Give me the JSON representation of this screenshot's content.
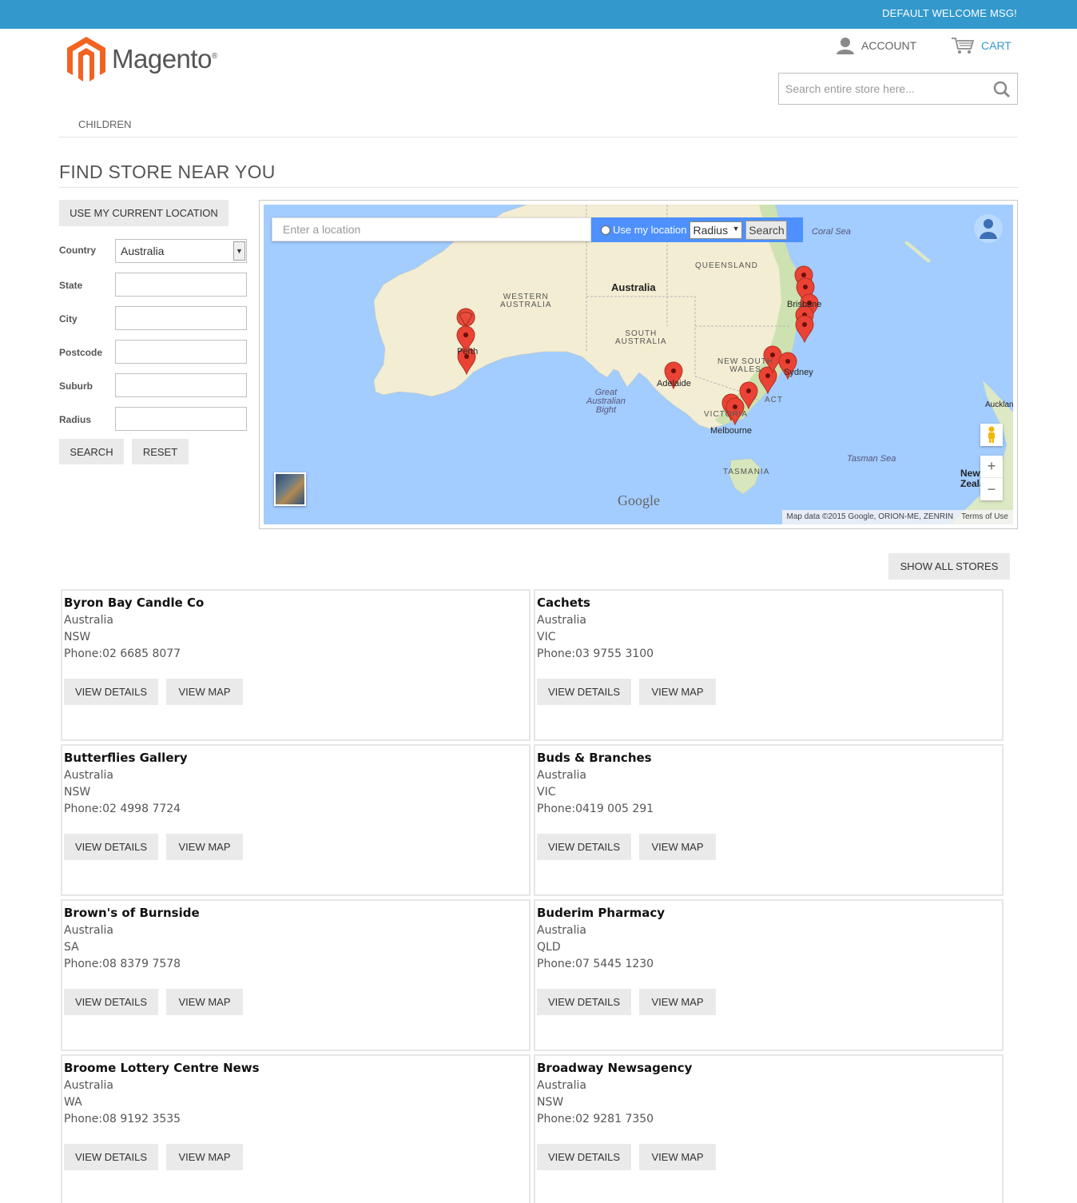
{
  "header": {
    "welcome": "DEFAULT WELCOME MSG!",
    "logo_text": "Magento",
    "logo_mark": "®",
    "account_label": "ACCOUNT",
    "cart_label": "CART",
    "search_placeholder": "Search entire store here..."
  },
  "nav": {
    "items": [
      "CHILDREN"
    ]
  },
  "page": {
    "title": "FIND STORE NEAR YOU"
  },
  "filter": {
    "use_location_label": "USE MY CURRENT LOCATION",
    "country_label": "Country",
    "country_value": "Australia",
    "state_label": "State",
    "city_label": "City",
    "postcode_label": "Postcode",
    "suburb_label": "Suburb",
    "radius_label": "Radius",
    "search_label": "SEARCH",
    "reset_label": "RESET"
  },
  "map": {
    "location_placeholder": "Enter a location",
    "use_my_location_label": "Use my location",
    "radius_value": "Radius",
    "search_label": "Search",
    "attribution": "Map data ©2015 Google, ORION-ME, ZENRIN",
    "terms": "Terms of Use",
    "google": "Google",
    "labels": {
      "australia": "Australia",
      "queensland": "QUEENSLAND",
      "western_australia_1": "WESTERN",
      "western_australia_2": "AUSTRALIA",
      "south_australia_1": "SOUTH",
      "south_australia_2": "AUSTRALIA",
      "nsw_1": "NEW SOUTH",
      "nsw_2": "WALES",
      "act": "ACT",
      "victoria": "VICTORIA",
      "tasmania": "TASMANIA",
      "coral_sea": "Coral Sea",
      "tasman_sea": "Tasman Sea",
      "bight_1": "Great",
      "bight_2": "Australian",
      "bight_3": "Bight",
      "brisbane": "Brisbane",
      "sydney": "Sydney",
      "adelaide": "Adelaide",
      "melbourne": "Melbourne",
      "perth": "Perth",
      "auckland": "Auckland",
      "nz_1": "New",
      "nz_2": "Zealand"
    }
  },
  "stores_section": {
    "show_all_label": "SHOW ALL STORES"
  },
  "store_buttons": {
    "view_details": "VIEW DETAILS",
    "view_map": "VIEW MAP",
    "phone_prefix": "Phone:"
  },
  "stores": [
    {
      "name": "Byron Bay Candle Co",
      "country": "Australia",
      "state": "NSW",
      "phone": "02 6685 8077"
    },
    {
      "name": "Cachets",
      "country": "Australia",
      "state": "VIC",
      "phone": "03 9755 3100"
    },
    {
      "name": "Butterflies Gallery",
      "country": "Australia",
      "state": "NSW",
      "phone": "02 4998 7724"
    },
    {
      "name": "Buds & Branches",
      "country": "Australia",
      "state": "VIC",
      "phone": "0419 005 291"
    },
    {
      "name": "Brown's of Burnside",
      "country": "Australia",
      "state": "SA",
      "phone": "08 8379 7578"
    },
    {
      "name": "Buderim Pharmacy",
      "country": "Australia",
      "state": "QLD",
      "phone": "07 5445 1230"
    },
    {
      "name": "Broome Lottery Centre News",
      "country": "Australia",
      "state": "WA",
      "phone": "08 9192 3535"
    },
    {
      "name": "Broadway Newsagency",
      "country": "Australia",
      "state": "NSW",
      "phone": "02 9281 7350"
    }
  ]
}
